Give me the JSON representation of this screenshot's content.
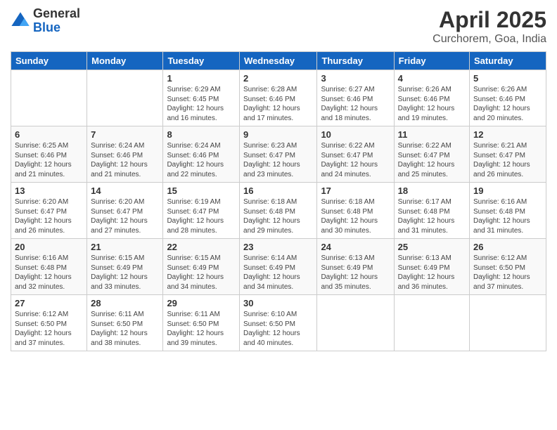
{
  "logo": {
    "general": "General",
    "blue": "Blue"
  },
  "header": {
    "title": "April 2025",
    "subtitle": "Curchorem, Goa, India"
  },
  "days": [
    "Sunday",
    "Monday",
    "Tuesday",
    "Wednesday",
    "Thursday",
    "Friday",
    "Saturday"
  ],
  "weeks": [
    [
      {
        "num": "",
        "info": ""
      },
      {
        "num": "",
        "info": ""
      },
      {
        "num": "1",
        "info": "Sunrise: 6:29 AM\nSunset: 6:45 PM\nDaylight: 12 hours and 16 minutes."
      },
      {
        "num": "2",
        "info": "Sunrise: 6:28 AM\nSunset: 6:46 PM\nDaylight: 12 hours and 17 minutes."
      },
      {
        "num": "3",
        "info": "Sunrise: 6:27 AM\nSunset: 6:46 PM\nDaylight: 12 hours and 18 minutes."
      },
      {
        "num": "4",
        "info": "Sunrise: 6:26 AM\nSunset: 6:46 PM\nDaylight: 12 hours and 19 minutes."
      },
      {
        "num": "5",
        "info": "Sunrise: 6:26 AM\nSunset: 6:46 PM\nDaylight: 12 hours and 20 minutes."
      }
    ],
    [
      {
        "num": "6",
        "info": "Sunrise: 6:25 AM\nSunset: 6:46 PM\nDaylight: 12 hours and 21 minutes."
      },
      {
        "num": "7",
        "info": "Sunrise: 6:24 AM\nSunset: 6:46 PM\nDaylight: 12 hours and 21 minutes."
      },
      {
        "num": "8",
        "info": "Sunrise: 6:24 AM\nSunset: 6:46 PM\nDaylight: 12 hours and 22 minutes."
      },
      {
        "num": "9",
        "info": "Sunrise: 6:23 AM\nSunset: 6:47 PM\nDaylight: 12 hours and 23 minutes."
      },
      {
        "num": "10",
        "info": "Sunrise: 6:22 AM\nSunset: 6:47 PM\nDaylight: 12 hours and 24 minutes."
      },
      {
        "num": "11",
        "info": "Sunrise: 6:22 AM\nSunset: 6:47 PM\nDaylight: 12 hours and 25 minutes."
      },
      {
        "num": "12",
        "info": "Sunrise: 6:21 AM\nSunset: 6:47 PM\nDaylight: 12 hours and 26 minutes."
      }
    ],
    [
      {
        "num": "13",
        "info": "Sunrise: 6:20 AM\nSunset: 6:47 PM\nDaylight: 12 hours and 26 minutes."
      },
      {
        "num": "14",
        "info": "Sunrise: 6:20 AM\nSunset: 6:47 PM\nDaylight: 12 hours and 27 minutes."
      },
      {
        "num": "15",
        "info": "Sunrise: 6:19 AM\nSunset: 6:47 PM\nDaylight: 12 hours and 28 minutes."
      },
      {
        "num": "16",
        "info": "Sunrise: 6:18 AM\nSunset: 6:48 PM\nDaylight: 12 hours and 29 minutes."
      },
      {
        "num": "17",
        "info": "Sunrise: 6:18 AM\nSunset: 6:48 PM\nDaylight: 12 hours and 30 minutes."
      },
      {
        "num": "18",
        "info": "Sunrise: 6:17 AM\nSunset: 6:48 PM\nDaylight: 12 hours and 31 minutes."
      },
      {
        "num": "19",
        "info": "Sunrise: 6:16 AM\nSunset: 6:48 PM\nDaylight: 12 hours and 31 minutes."
      }
    ],
    [
      {
        "num": "20",
        "info": "Sunrise: 6:16 AM\nSunset: 6:48 PM\nDaylight: 12 hours and 32 minutes."
      },
      {
        "num": "21",
        "info": "Sunrise: 6:15 AM\nSunset: 6:49 PM\nDaylight: 12 hours and 33 minutes."
      },
      {
        "num": "22",
        "info": "Sunrise: 6:15 AM\nSunset: 6:49 PM\nDaylight: 12 hours and 34 minutes."
      },
      {
        "num": "23",
        "info": "Sunrise: 6:14 AM\nSunset: 6:49 PM\nDaylight: 12 hours and 34 minutes."
      },
      {
        "num": "24",
        "info": "Sunrise: 6:13 AM\nSunset: 6:49 PM\nDaylight: 12 hours and 35 minutes."
      },
      {
        "num": "25",
        "info": "Sunrise: 6:13 AM\nSunset: 6:49 PM\nDaylight: 12 hours and 36 minutes."
      },
      {
        "num": "26",
        "info": "Sunrise: 6:12 AM\nSunset: 6:50 PM\nDaylight: 12 hours and 37 minutes."
      }
    ],
    [
      {
        "num": "27",
        "info": "Sunrise: 6:12 AM\nSunset: 6:50 PM\nDaylight: 12 hours and 37 minutes."
      },
      {
        "num": "28",
        "info": "Sunrise: 6:11 AM\nSunset: 6:50 PM\nDaylight: 12 hours and 38 minutes."
      },
      {
        "num": "29",
        "info": "Sunrise: 6:11 AM\nSunset: 6:50 PM\nDaylight: 12 hours and 39 minutes."
      },
      {
        "num": "30",
        "info": "Sunrise: 6:10 AM\nSunset: 6:50 PM\nDaylight: 12 hours and 40 minutes."
      },
      {
        "num": "",
        "info": ""
      },
      {
        "num": "",
        "info": ""
      },
      {
        "num": "",
        "info": ""
      }
    ]
  ]
}
